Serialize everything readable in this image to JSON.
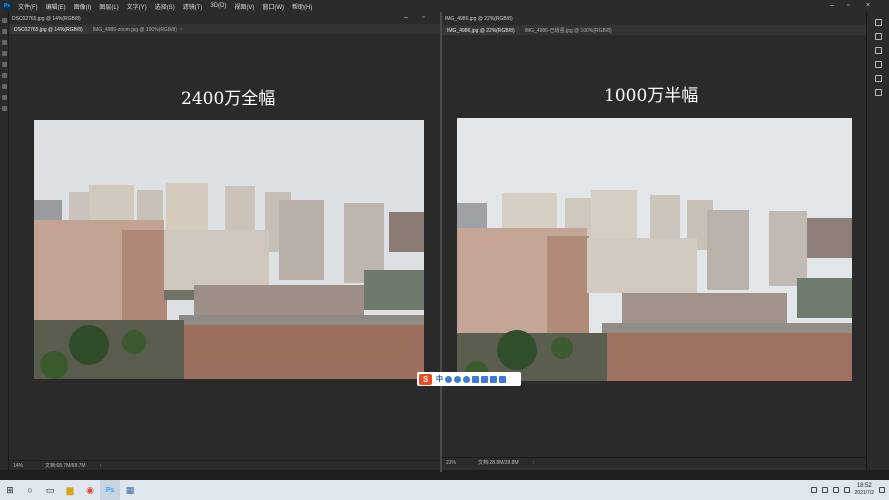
{
  "app": {
    "logo": "Ps",
    "menu": [
      "文件(F)",
      "编辑(E)",
      "图像(I)",
      "图层(L)",
      "文字(Y)",
      "选择(S)",
      "滤镜(T)",
      "3D(D)",
      "视图(V)",
      "窗口(W)",
      "帮助(H)"
    ]
  },
  "left_doc": {
    "window_title": "DSC02765.jpg @ 14%(RGB/8)",
    "tabs": [
      {
        "label": "DSC02765.jpg @ 14%(RGB/8)",
        "active": true
      },
      {
        "label": "IMG_4986-zoom.jpg @ 100%(RGB/8)",
        "active": false
      }
    ],
    "caption": "2400万全幅",
    "status": {
      "zoom": "14%",
      "info": "文档:68.7M/68.7M",
      "arrow": "›"
    }
  },
  "right_doc": {
    "window_title": "IMG_4986.jpg @ 22%(RGB/8)",
    "tabs": [
      {
        "label": "IMG_4986.jpg @ 22%(RGB/8)",
        "active": true
      },
      {
        "label": "IMG_4986-已增强.jpg @ 100%(RGB/8)",
        "active": false
      }
    ],
    "caption": "1000万半幅",
    "status": {
      "zoom": "22%",
      "info": "文档:28.8M/28.8M",
      "arrow": "›"
    }
  },
  "ime": {
    "logo": "S",
    "lang": "中"
  },
  "taskbar": {
    "items": [
      {
        "icon": "windows-icon",
        "glyph": "⊞"
      },
      {
        "icon": "search-icon",
        "glyph": "○"
      },
      {
        "icon": "task-view-icon",
        "glyph": "▭"
      },
      {
        "icon": "folder-icon",
        "glyph": "▆"
      },
      {
        "icon": "chrome-icon",
        "glyph": "◉"
      },
      {
        "icon": "photoshop-icon",
        "glyph": "Ps"
      },
      {
        "icon": "calculator-icon",
        "glyph": "▦"
      }
    ],
    "clock": {
      "time": "18:52",
      "date": "2021/7/2"
    }
  },
  "colors": {
    "sky": "#dfe3e6",
    "building": "#b9a99b",
    "brick": "#8a5a4a"
  }
}
